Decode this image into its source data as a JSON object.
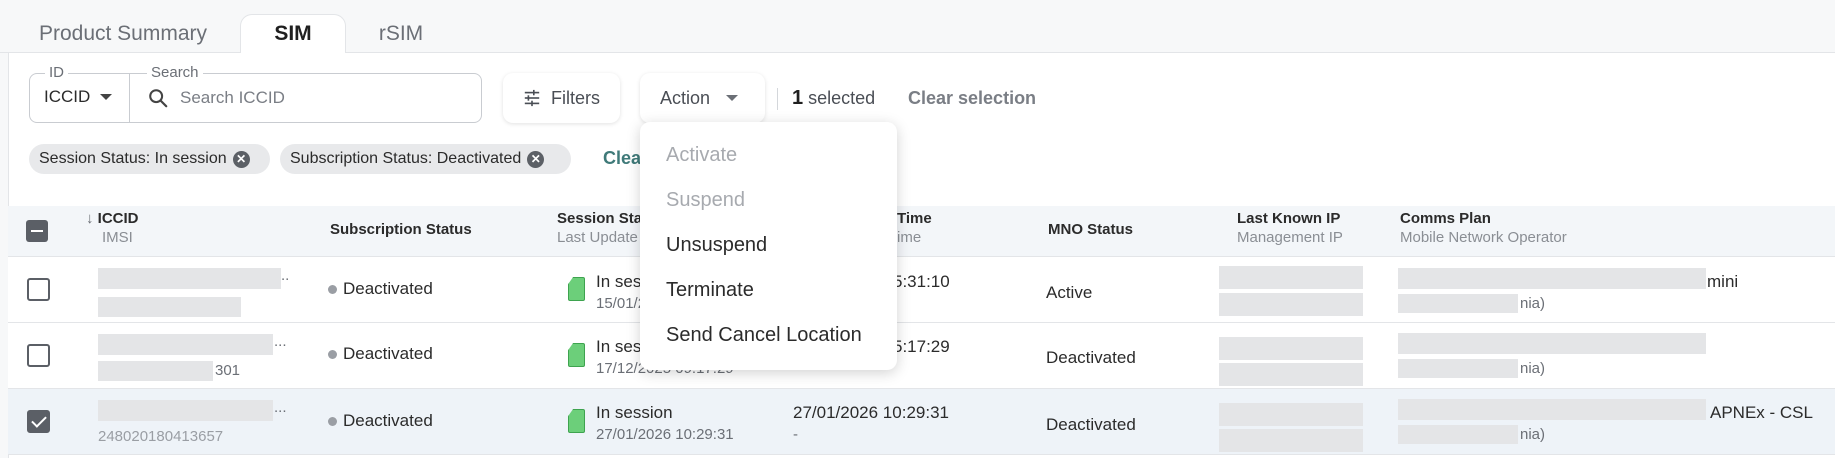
{
  "tabs": [
    {
      "label": "Product Summary"
    },
    {
      "label": "SIM"
    },
    {
      "label": "rSIM"
    }
  ],
  "toolbar": {
    "id_legend": "ID",
    "id_value": "ICCID",
    "search_legend": "Search",
    "search_placeholder": "Search ICCID",
    "filters_label": "Filters",
    "action_label": "Action",
    "selected_count": "1",
    "selected_label": "selected",
    "clear_selection": "Clear selection"
  },
  "chips": [
    {
      "label": "Session Status: In session"
    },
    {
      "label": "Subscription Status: Deactivated"
    }
  ],
  "clear_all_partial": "Clea",
  "columns": {
    "iccid": "ICCID",
    "iccid_sub": "IMSI",
    "subscription": "Subscription Status",
    "session": "Session Sta",
    "session_sub": "Last Update",
    "time": "Time",
    "time_sub": "ime",
    "mno": "MNO Status",
    "ip": "Last Known IP",
    "ip_sub": "Management IP",
    "plan": "Comms Plan",
    "plan_sub": "Mobile Network Operator"
  },
  "rows": [
    {
      "checked": false,
      "iccid_tail": "..",
      "imsi_tail": "",
      "subscription": "Deactivated",
      "session": "In sessi",
      "session_date": "15/01/2",
      "time": "5:31:10",
      "mno": "Active",
      "plan_tail": "mini",
      "operator_tail": "nia)"
    },
    {
      "checked": false,
      "iccid_tail": "...",
      "imsi_tail": "301",
      "subscription": "Deactivated",
      "session": "In sess",
      "session_date": "17/12/2025 09:17:29",
      "time": "5:17:29",
      "mno": "Deactivated",
      "plan_tail": "",
      "operator_tail": "nia)"
    },
    {
      "checked": true,
      "iccid_tail": "...",
      "imsi_tail": "248020180413657",
      "subscription": "Deactivated",
      "session": "In session",
      "session_date": "27/01/2026 10:29:31",
      "time": "27/01/2026 10:29:31",
      "time_sub": "-",
      "mno": "Deactivated",
      "plan_tail": "APNEx - CSL",
      "operator_tail": "nia)"
    }
  ],
  "action_menu": [
    {
      "label": "Activate",
      "enabled": false
    },
    {
      "label": "Suspend",
      "enabled": false
    },
    {
      "label": "Unsuspend",
      "enabled": true
    },
    {
      "label": "Terminate",
      "enabled": true
    },
    {
      "label": "Send Cancel Location",
      "enabled": true
    }
  ],
  "colors": {
    "accent": "#3f7a79",
    "sim_green": "#6ccf7a",
    "checkbox": "#5b5f66"
  }
}
